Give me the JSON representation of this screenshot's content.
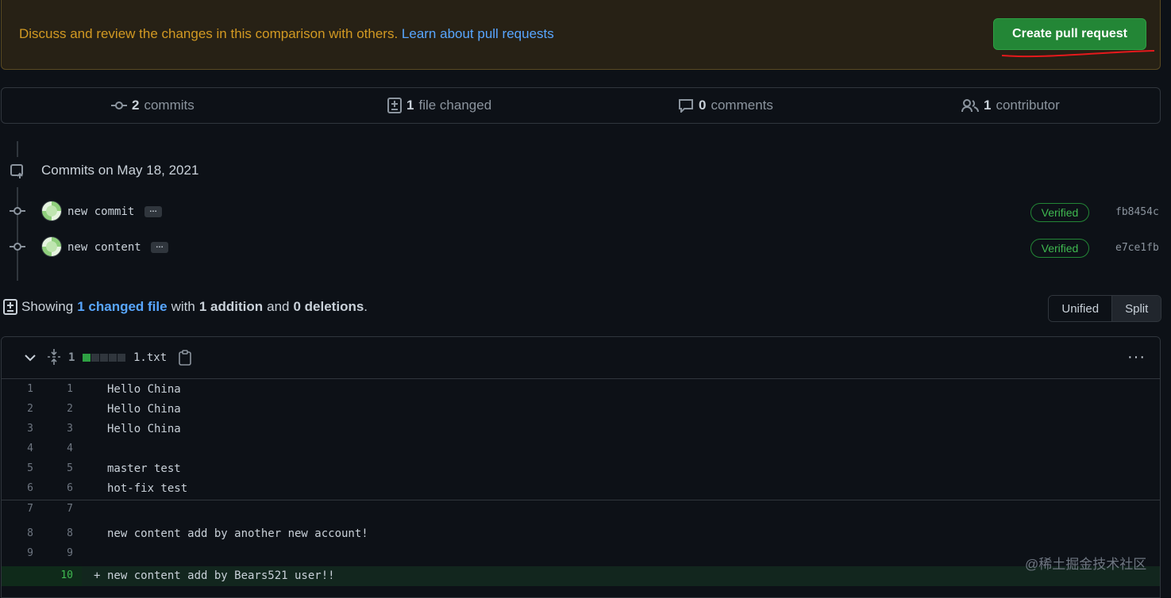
{
  "banner": {
    "text": "Discuss and review the changes in this comparison with others.",
    "link": "Learn about pull requests",
    "button": "Create pull request"
  },
  "stats": {
    "commits": {
      "count": "2",
      "label": "commits"
    },
    "files": {
      "count": "1",
      "label": "file changed"
    },
    "comments": {
      "count": "0",
      "label": "comments"
    },
    "contributors": {
      "count": "1",
      "label": "contributor"
    }
  },
  "commits_header": "Commits on May 18, 2021",
  "commits": [
    {
      "message": "new commit",
      "ellipsis": "…",
      "status": "Verified",
      "sha": "fb8454c"
    },
    {
      "message": "new content",
      "ellipsis": "…",
      "status": "Verified",
      "sha": "e7ce1fb"
    }
  ],
  "summary": {
    "prefix": "Showing",
    "files_link": "1 changed file",
    "with": "with",
    "additions": "1 addition",
    "and": "and",
    "deletions": "0 deletions",
    "end": "."
  },
  "view_toggle": {
    "unified": "Unified",
    "split": "Split"
  },
  "file": {
    "diff_count": "1",
    "name": "1.txt",
    "more": "···",
    "lines": [
      {
        "old": "1",
        "new": "1",
        "text": "Hello China"
      },
      {
        "old": "2",
        "new": "2",
        "text": "Hello China"
      },
      {
        "old": "3",
        "new": "3",
        "text": "Hello China"
      },
      {
        "old": "4",
        "new": "4",
        "text": ""
      },
      {
        "old": "5",
        "new": "5",
        "text": "master test"
      },
      {
        "old": "6",
        "new": "6",
        "text": "hot-fix test"
      },
      {
        "old": "7",
        "new": "7",
        "text": ""
      },
      {
        "old": "8",
        "new": "8",
        "text": "new content add by another new account!"
      },
      {
        "old": "9",
        "new": "9",
        "text": ""
      }
    ],
    "added_line": {
      "new": "10",
      "sign": "+",
      "text": "new content add by Bears521 user!!"
    }
  },
  "watermark": "@稀土掘金技术社区",
  "colors": {
    "accent": "#238636",
    "link": "#58a6ff",
    "warning": "#d29922",
    "added_bg": "#12261e"
  }
}
